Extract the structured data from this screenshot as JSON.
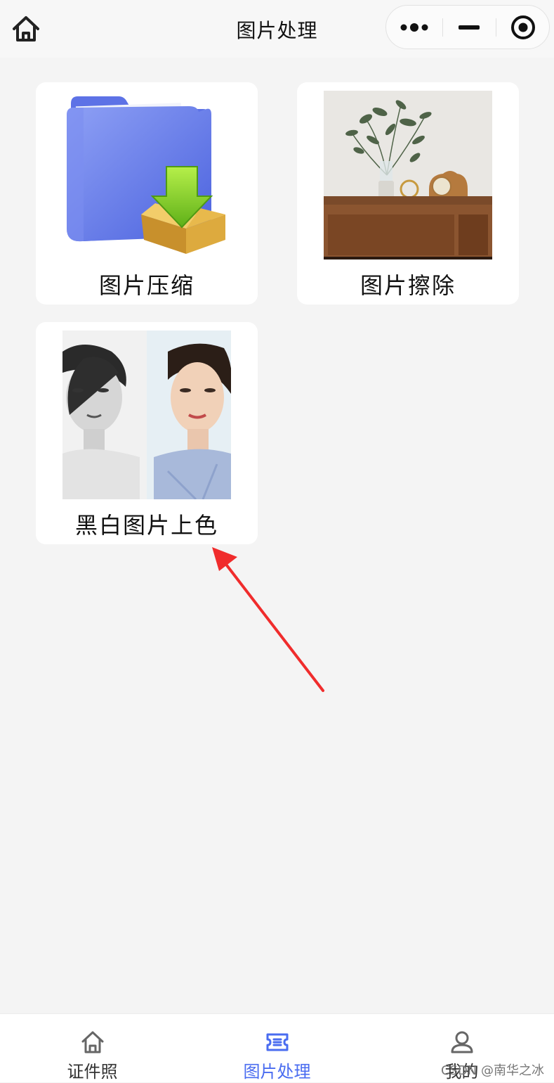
{
  "navbar": {
    "title": "图片处理",
    "home_icon": "home-icon",
    "more_icon": "more-dots-icon",
    "minimize_icon": "minimize-icon",
    "close_icon": "record-target-icon"
  },
  "cards": [
    {
      "label": "图片压缩",
      "image": "folder-download-illustration"
    },
    {
      "label": "图片擦除",
      "image": "vase-and-clock-on-shelf-photo"
    },
    {
      "label": "黑白图片上色",
      "image": "black-white-and-colorized-portrait-photo"
    }
  ],
  "tabbar": {
    "items": [
      {
        "label": "证件照",
        "icon": "home-icon",
        "active": false
      },
      {
        "label": "图片处理",
        "icon": "ticket-icon",
        "active": true
      },
      {
        "label": "我的",
        "icon": "user-icon",
        "active": false
      }
    ]
  },
  "watermark": "CSDN @南华之冰",
  "colors": {
    "accent": "#4a6cf0",
    "background": "#f4f4f4",
    "annotation_arrow": "#f02c2c"
  }
}
